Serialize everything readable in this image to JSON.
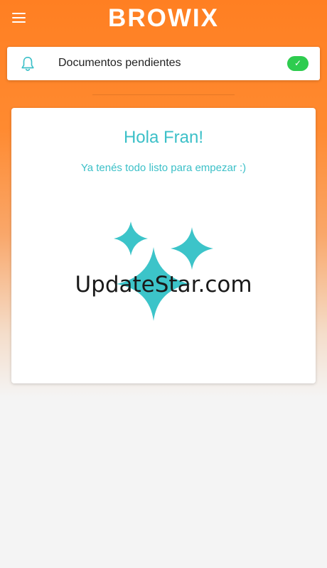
{
  "header": {
    "logo": "BROWIX",
    "menu_icon": "hamburger-menu-icon"
  },
  "pending": {
    "icon": "bell-icon",
    "label": "Documentos pendientes",
    "status_icon": "check-icon",
    "status_glyph": "✓",
    "status_color": "#2ecc4f"
  },
  "welcome": {
    "greeting": "Hola Fran!",
    "subtitle": "Ya tenés todo listo para empezar :)",
    "illustration": "sparkles-icon",
    "watermark": "UpdateStar.com"
  },
  "colors": {
    "header_orange": "#ff7f22",
    "accent_teal": "#3cc0c8",
    "background": "#f4f4f4"
  }
}
